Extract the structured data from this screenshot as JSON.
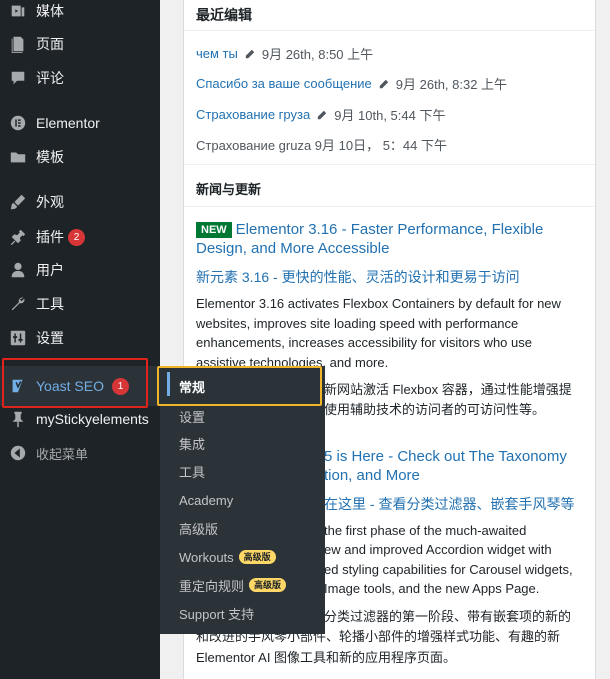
{
  "sidebar": {
    "items": [
      {
        "label": "媒体",
        "icon": "media-icon"
      },
      {
        "label": "页面",
        "icon": "page-icon"
      },
      {
        "label": "评论",
        "icon": "comment-icon"
      },
      {
        "label": "Elementor",
        "icon": "elementor-icon"
      },
      {
        "label": "模板",
        "icon": "folder-icon"
      },
      {
        "label": "外观",
        "icon": "brush-icon"
      },
      {
        "label": "插件",
        "icon": "plugin-icon",
        "badge": "2"
      },
      {
        "label": "用户",
        "icon": "user-icon"
      },
      {
        "label": "工具",
        "icon": "wrench-icon"
      },
      {
        "label": "设置",
        "icon": "settings-icon"
      },
      {
        "label": "Yoast SEO",
        "icon": "yoast-icon",
        "badge": "1"
      },
      {
        "label": "myStickyelements",
        "icon": "pin-icon"
      },
      {
        "label": "收起菜单",
        "icon": "collapse-icon"
      }
    ]
  },
  "flyout": {
    "items": [
      {
        "label": "常规"
      },
      {
        "label": "设置"
      },
      {
        "label": "集成"
      },
      {
        "label": "工具"
      },
      {
        "label": "Academy"
      },
      {
        "label": "高级版"
      },
      {
        "label": "Workouts",
        "tag": "高级版"
      },
      {
        "label": "重定向规则",
        "tag": "高级版"
      },
      {
        "label": "Support 支持"
      }
    ]
  },
  "recent": {
    "title": "最近编辑",
    "items": [
      {
        "link": "чем ты",
        "date": "9月 26th, 8:50 上午",
        "editable": true
      },
      {
        "link": "Спасибо за ваше сообщение",
        "date": "9月 26th, 8:32 上午",
        "editable": true
      },
      {
        "link": "Страхование груза",
        "date": "9月 10th, 5:44 下午",
        "editable": true
      },
      {
        "link": "",
        "date": "Страхование gruza 9月 10日， 5：44 下午",
        "editable": false
      }
    ]
  },
  "news": {
    "title": "新闻与更新",
    "new_badge": "NEW",
    "item1_title": "Elementor 3.16 - Faster Performance, Flexible Design, and More Accessible",
    "item1_zh": "新元素 3.16 - 更快的性能、灵活的设计和更易于访问",
    "item1_body_en": "Elementor 3.16 activates Flexbox Containers by default for new websites, improves site loading speed with performance enhancements, increases accessibility for visitors who use assistive technologies, and more.",
    "item1_body_zh_1": "新网站激活 Flexbox 容器，通过性能增强提",
    "item1_body_zh_2": "使用辅助技术的访问者的可访问性等。",
    "item2_title_1": "5 is Here - Check out The Taxonomy",
    "item2_title_2": "tion, and More",
    "item2_zh": "在这里 - 查看分类过滤器、嵌套手风琴等",
    "item2_body_en_1": "the first phase of the much-awaited",
    "item2_body_en_2": "ew and improved Accordion widget with",
    "item2_body_en_3": "ed styling capabilities for Carousel widgets,",
    "item2_body_en_4": "Image tools, and the new Apps Page.",
    "item2_body_zh_1": "分类过滤器的第一阶段、带有嵌套项的新的",
    "item2_body_zh_2": "和改进的手风琴小部件、轮播小部件的增强样式功能、有趣的新",
    "item2_body_zh_3": "Elementor AI 图像工具和新的应用程序页面。"
  }
}
